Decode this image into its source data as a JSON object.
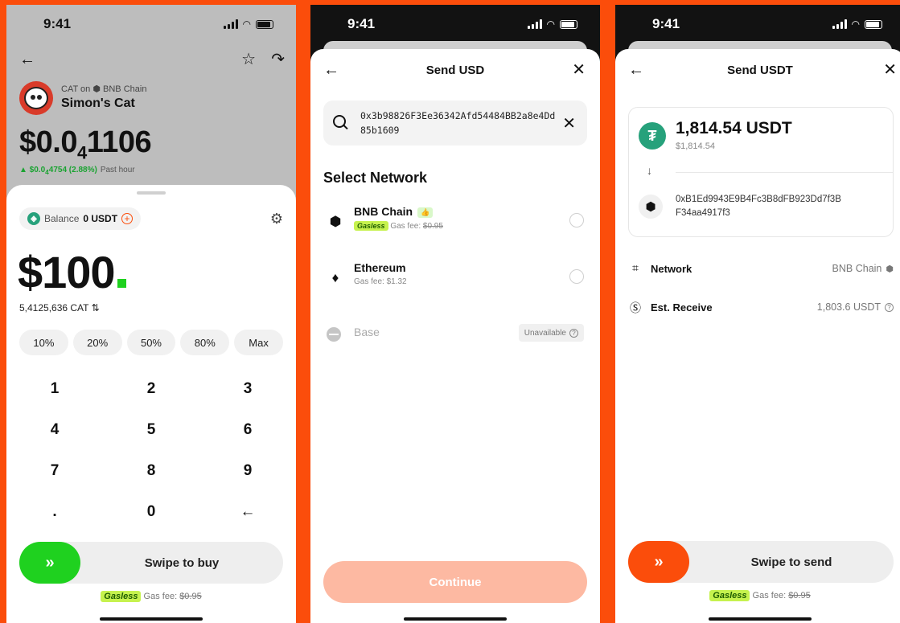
{
  "status_time": "9:41",
  "colors": {
    "accent": "#fb4d0b",
    "green": "#1fd11f",
    "tether": "#26a17b",
    "gasless_bg": "#c6f24e"
  },
  "screen_buy": {
    "token_chain_text": "CAT on 🟨 BNB Chain",
    "token_chain_prefix": "CAT on",
    "token_chain": "BNB Chain",
    "token_name": "Simon's Cat",
    "price_main": "$0.0",
    "price_sub": "4",
    "price_tail": "1106",
    "change_main": "▲ $0.0",
    "change_sub": "4",
    "change_tail": "4754 (2.88%)",
    "change_period": "Past hour",
    "balance_label": "Balance",
    "balance_value": "0 USDT",
    "amount": "$100",
    "cat_amount": "5,4125,636 CAT",
    "swap_glyph": "⇅",
    "percent_options": [
      "10%",
      "20%",
      "50%",
      "80%",
      "Max"
    ],
    "keys": [
      [
        "1",
        "2",
        "3"
      ],
      [
        "4",
        "5",
        "6"
      ],
      [
        "7",
        "8",
        "9"
      ],
      [
        ".",
        "0",
        "←"
      ]
    ],
    "swipe_label": "Swipe to buy",
    "gasless": "Gasless",
    "gas_fee_label": "Gas fee:",
    "gas_fee_value": "$0.95"
  },
  "screen_network": {
    "title": "Send USD",
    "search_value": "0x3b98826F3Ee36342Afd54484BB2a8e4Dd85b1609",
    "section_title": "Select Network",
    "networks": [
      {
        "name": "BNB Chain",
        "gasless": "Gasless",
        "fee_label": "Gas fee:",
        "fee_value": "$0.95",
        "badge": "👍"
      },
      {
        "name": "Ethereum",
        "fee_text": "Gas fee: $1.32"
      },
      {
        "name": "Base",
        "status": "Unavailable"
      }
    ],
    "continue_label": "Continue"
  },
  "screen_send": {
    "title": "Send USDT",
    "amount": "1,814.54 USDT",
    "amount_usd": "$1,814.54",
    "to_address": "0xB1Ed9943E9B4Fc3B8dFB923Dd7f3BF34aa4917f3",
    "network_label": "Network",
    "network_value": "BNB Chain",
    "receive_label": "Est. Receive",
    "receive_value": "1,803.6 USDT",
    "swipe_label": "Swipe to send",
    "gasless": "Gasless",
    "gas_fee_label": "Gas fee:",
    "gas_fee_value": "$0.95"
  }
}
